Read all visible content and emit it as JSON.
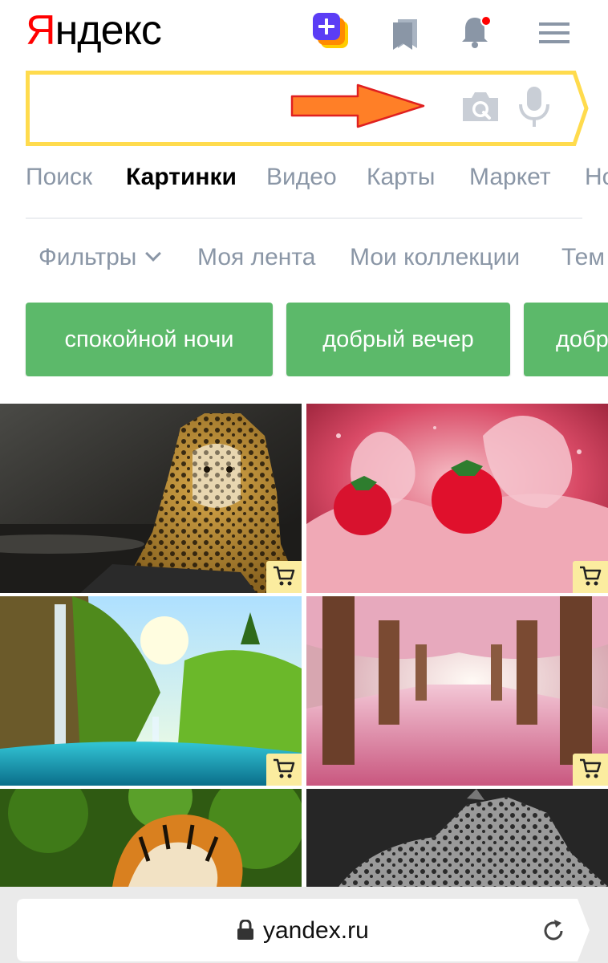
{
  "header": {
    "logo_first": "Я",
    "logo_rest": "ндекс",
    "icons": [
      "plus-icon",
      "bookmark-icon",
      "bell-icon",
      "menu-icon"
    ],
    "notification_dot_color": "#ff0000"
  },
  "search": {
    "value": "",
    "border_color": "#ffdb4d",
    "icons": [
      "camera-icon",
      "microphone-icon"
    ],
    "annotation": "orange-arrow"
  },
  "services": [
    {
      "label": "Поиск",
      "active": false
    },
    {
      "label": "Картинки",
      "active": true
    },
    {
      "label": "Видео",
      "active": false
    },
    {
      "label": "Карты",
      "active": false
    },
    {
      "label": "Маркет",
      "active": false
    },
    {
      "label": "Но",
      "active": false
    }
  ],
  "filters": [
    {
      "label": "Фильтры"
    },
    {
      "label": "Моя лента"
    },
    {
      "label": "Мои коллекции"
    },
    {
      "label": "Тем"
    }
  ],
  "chips": [
    {
      "label": "спокойной ночи"
    },
    {
      "label": "добрый вечер"
    },
    {
      "label": "добр"
    }
  ],
  "chip_color": "#5cb96a",
  "images": [
    {
      "subject": "jaguar on rock",
      "has_cart": true
    },
    {
      "subject": "strawberries splashing in milk",
      "has_cart": true
    },
    {
      "subject": "waterfall with turquoise lake",
      "has_cart": true
    },
    {
      "subject": "alley of trees with pink blossoms",
      "has_cart": true
    },
    {
      "subject": "tiger in green jungle",
      "has_cart": false
    },
    {
      "subject": "black and white leopard",
      "has_cart": false
    }
  ],
  "cart_badge_color": "#fbec9f",
  "browser": {
    "url": "yandex.ru",
    "icons": [
      "lock-icon",
      "reload-icon"
    ]
  }
}
